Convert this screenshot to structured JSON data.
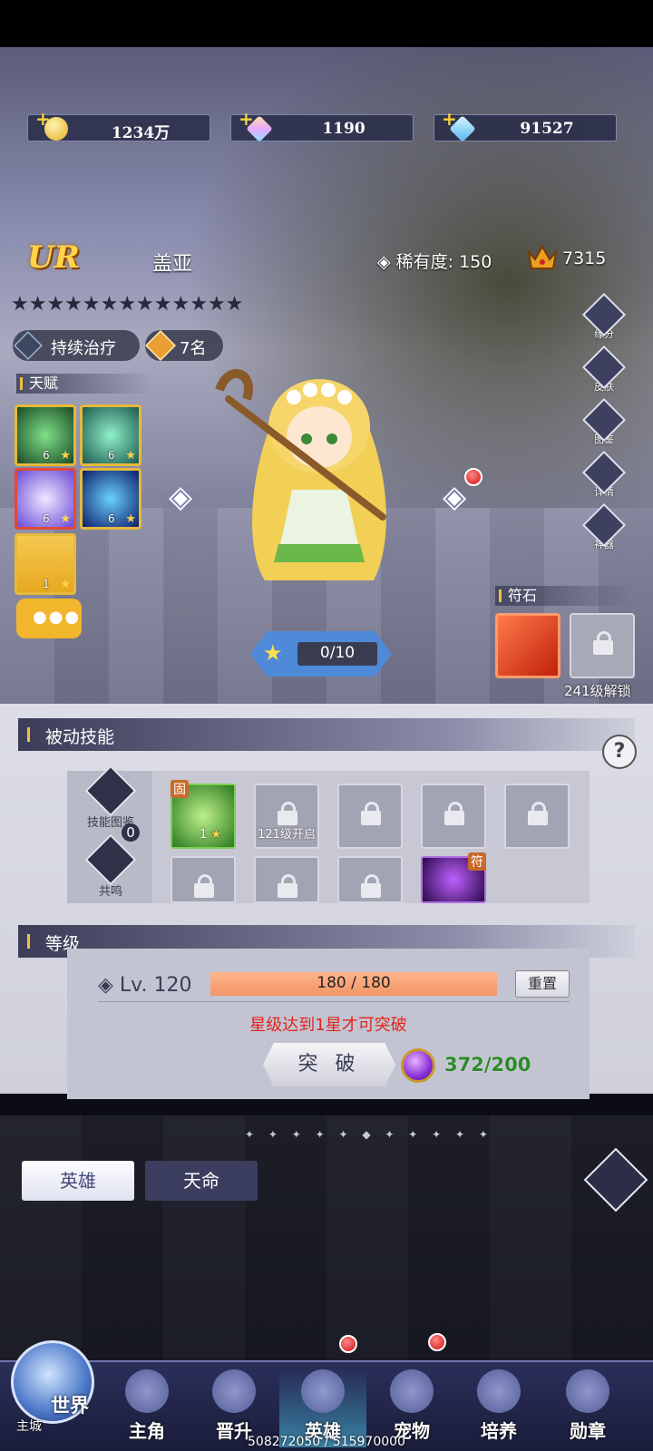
{
  "currencies": [
    {
      "name": "gold",
      "value": "1234万",
      "color": "#f2c23a"
    },
    {
      "name": "rainbow-gem",
      "value": "1190",
      "color": "#e8a8ff"
    },
    {
      "name": "diamond",
      "value": "91527",
      "color": "#7fd8ff"
    }
  ],
  "hero": {
    "grade": "UR",
    "name": "盖亚",
    "rarity": "稀有度: 150",
    "power": "7315",
    "stars": "★★★★★★★★★★★★★",
    "skill_tag": "持续治疗",
    "rank": "7名"
  },
  "talent": {
    "title": "天赋",
    "items": [
      {
        "level": "6",
        "color": "#2e6a3a"
      },
      {
        "level": "6",
        "color": "#2f7a66"
      },
      {
        "level": "6",
        "color": "#6a4ad8"
      },
      {
        "level": "6",
        "color": "#1d3c9a"
      },
      {
        "level": "1",
        "color": "#ece6d0"
      }
    ]
  },
  "side_buttons": [
    "缘分",
    "皮肤",
    "图鉴",
    "详情",
    "神器"
  ],
  "exp": {
    "value": "0/10",
    "fraction": 0.0
  },
  "rune": {
    "title": "符石",
    "unlock_text": "241级解锁"
  },
  "passive": {
    "title": "被动技能",
    "help": "?",
    "skill_atlas": "技能图鉴",
    "resonance": "共鸣",
    "resonance_count": "0",
    "first_skill_level": "1",
    "first_skill_badge": "固",
    "unlock_text": "121级开启",
    "last_skill_badge": "符"
  },
  "level": {
    "title": "等级",
    "label": "Lv. 120",
    "progress": "180 / 180",
    "fraction": 1.0,
    "reset": "重置",
    "warning": "星级达到1星才可突破",
    "break_button": "突 破",
    "orb_count": "372/200"
  },
  "tabs": {
    "hero": "英雄",
    "fate": "天命"
  },
  "nav": {
    "world": "世界",
    "world_sub": "主城",
    "items": [
      "主角",
      "晋升",
      "英雄",
      "宠物",
      "培养",
      "勋章"
    ],
    "active": "英雄"
  },
  "footer": "508272050 / 515970000"
}
